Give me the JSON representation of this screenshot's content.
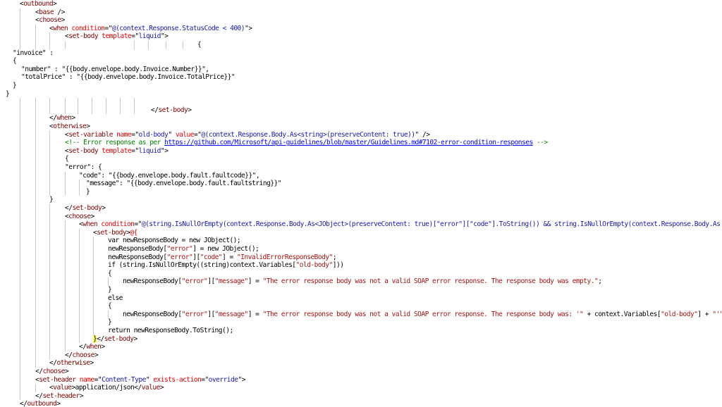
{
  "editor": {
    "lines": [
      {
        "segs": [
          {
            "c": "p",
            "t": "<"
          },
          {
            "c": "t",
            "t": "outbound"
          },
          {
            "c": "p",
            "t": ">"
          }
        ]
      },
      {
        "segs": [
          {
            "c": "p",
            "t": "<"
          },
          {
            "c": "t",
            "t": "base"
          },
          {
            "c": "p",
            "t": " />"
          }
        ]
      },
      {
        "segs": [
          {
            "c": "p",
            "t": "<"
          },
          {
            "c": "t",
            "t": "choose"
          },
          {
            "c": "p",
            "t": ">"
          }
        ]
      },
      {
        "segs": [
          {
            "c": "p",
            "t": "<"
          },
          {
            "c": "t",
            "t": "when"
          },
          {
            "c": "a",
            "t": " condition"
          },
          {
            "c": "p",
            "t": "=\""
          },
          {
            "c": "v",
            "t": "@(context.Response.StatusCode < 400)"
          },
          {
            "c": "p",
            "t": "\">"
          }
        ]
      },
      {
        "segs": [
          {
            "c": "p",
            "t": "<"
          },
          {
            "c": "t",
            "t": "set-body"
          },
          {
            "c": "a",
            "t": " template"
          },
          {
            "c": "p",
            "t": "=\""
          },
          {
            "c": "v",
            "t": "liquid"
          },
          {
            "c": "p",
            "t": "\">"
          }
        ]
      },
      {
        "segs": [
          {
            "c": "p",
            "t": "{"
          }
        ]
      },
      {
        "segs": [
          {
            "c": "p",
            "t": "\"invoice\" :"
          }
        ]
      },
      {
        "segs": [
          {
            "c": "p",
            "t": "{"
          }
        ]
      },
      {
        "segs": [
          {
            "c": "p",
            "t": "\"number\" : \"{{body.envelope.body.Invoice.Number}}\","
          }
        ]
      },
      {
        "segs": [
          {
            "c": "p",
            "t": "\"totalPrice\" : \"{{body.envelope.body.Invoice.TotalPrice}}\""
          }
        ]
      },
      {
        "segs": [
          {
            "c": "p",
            "t": "}"
          }
        ]
      },
      {
        "segs": [
          {
            "c": "p",
            "t": "}"
          }
        ]
      },
      {
        "segs": []
      },
      {
        "segs": [
          {
            "c": "p",
            "t": "</"
          },
          {
            "c": "t",
            "t": "set-body"
          },
          {
            "c": "p",
            "t": ">"
          }
        ]
      },
      {
        "segs": [
          {
            "c": "p",
            "t": "</"
          },
          {
            "c": "t",
            "t": "when"
          },
          {
            "c": "p",
            "t": ">"
          }
        ]
      },
      {
        "segs": [
          {
            "c": "p",
            "t": "<"
          },
          {
            "c": "t",
            "t": "otherwise"
          },
          {
            "c": "p",
            "t": ">"
          }
        ]
      },
      {
        "segs": [
          {
            "c": "p",
            "t": "<"
          },
          {
            "c": "t",
            "t": "set-variable"
          },
          {
            "c": "a",
            "t": " name"
          },
          {
            "c": "p",
            "t": "=\""
          },
          {
            "c": "v",
            "t": "old-body"
          },
          {
            "c": "p",
            "t": "\""
          },
          {
            "c": "a",
            "t": " value"
          },
          {
            "c": "p",
            "t": "=\""
          },
          {
            "c": "v",
            "t": "@(context.Response.Body.As<string>(preserveContent: true))"
          },
          {
            "c": "p",
            "t": "\" />"
          }
        ]
      },
      {
        "segs": [
          {
            "c": "c",
            "t": "<!-- Error response as per "
          },
          {
            "c": "u",
            "t": "https://github.com/Microsoft/api-guidelines/blob/master/Guidelines.md#7102-error-condition-responses"
          },
          {
            "c": "c",
            "t": " -->"
          }
        ]
      },
      {
        "segs": [
          {
            "c": "p",
            "t": "<"
          },
          {
            "c": "t",
            "t": "set-body"
          },
          {
            "c": "a",
            "t": " template"
          },
          {
            "c": "p",
            "t": "=\""
          },
          {
            "c": "v",
            "t": "liquid"
          },
          {
            "c": "p",
            "t": "\">"
          }
        ]
      },
      {
        "segs": [
          {
            "c": "p",
            "t": "{"
          }
        ]
      },
      {
        "segs": [
          {
            "c": "p",
            "t": "\"error\": {"
          }
        ]
      },
      {
        "segs": [
          {
            "c": "p",
            "t": "\"code\": \"{{body.envelope.body.fault.faultcode}}\","
          }
        ]
      },
      {
        "segs": [
          {
            "c": "p",
            "t": "\"message\": \"{{body.envelope.body.fault.faultstring}}\""
          }
        ]
      },
      {
        "segs": [
          {
            "c": "p",
            "t": "}"
          }
        ]
      },
      {
        "segs": [
          {
            "c": "p",
            "t": "}"
          }
        ]
      },
      {
        "segs": [
          {
            "c": "p",
            "t": "</"
          },
          {
            "c": "t",
            "t": "set-body"
          },
          {
            "c": "p",
            "t": ">"
          }
        ]
      },
      {
        "segs": [
          {
            "c": "p",
            "t": "<"
          },
          {
            "c": "t",
            "t": "choose"
          },
          {
            "c": "p",
            "t": ">"
          }
        ]
      },
      {
        "segs": [
          {
            "c": "p",
            "t": "<"
          },
          {
            "c": "t",
            "t": "when"
          },
          {
            "c": "a",
            "t": " condition"
          },
          {
            "c": "p",
            "t": "=\""
          },
          {
            "c": "v",
            "t": "@(string.IsNullOrEmpty(context.Response.Body.As<JObject>(preserveContent: true)[\"error\"][\"code\"].ToString()) && string.IsNullOrEmpty(context.Response.Body.As"
          }
        ]
      },
      {
        "segs": [
          {
            "c": "p",
            "t": "<"
          },
          {
            "c": "t",
            "t": "set-body"
          },
          {
            "c": "p",
            "t": ">"
          },
          {
            "c": "a",
            "t": "@{"
          }
        ]
      },
      {
        "segs": [
          {
            "c": "p",
            "t": "var newResponseBody = new JObject();"
          }
        ]
      },
      {
        "segs": [
          {
            "c": "p",
            "t": "newResponseBody["
          },
          {
            "c": "s",
            "t": "\"error\""
          },
          {
            "c": "p",
            "t": "] = new JObject();"
          }
        ]
      },
      {
        "segs": [
          {
            "c": "p",
            "t": "newResponseBody["
          },
          {
            "c": "s",
            "t": "\"error\""
          },
          {
            "c": "p",
            "t": "]["
          },
          {
            "c": "s",
            "t": "\"code\""
          },
          {
            "c": "p",
            "t": "] = "
          },
          {
            "c": "s",
            "t": "\"InvalidErrorResponseBody\""
          },
          {
            "c": "p",
            "t": ";"
          }
        ]
      },
      {
        "segs": [
          {
            "c": "p",
            "t": "if (string.IsNullOrEmpty((string)context.Variables["
          },
          {
            "c": "s",
            "t": "\"old-body\""
          },
          {
            "c": "p",
            "t": "]))"
          }
        ]
      },
      {
        "segs": [
          {
            "c": "p",
            "t": "{"
          }
        ]
      },
      {
        "segs": [
          {
            "c": "p",
            "t": "newResponseBody["
          },
          {
            "c": "s",
            "t": "\"error\""
          },
          {
            "c": "p",
            "t": "]["
          },
          {
            "c": "s",
            "t": "\"message\""
          },
          {
            "c": "p",
            "t": "] = "
          },
          {
            "c": "s",
            "t": "\"The error response body was not a valid SOAP error response. The response body was empty.\""
          },
          {
            "c": "p",
            "t": ";"
          }
        ]
      },
      {
        "segs": [
          {
            "c": "p",
            "t": "}"
          }
        ]
      },
      {
        "segs": [
          {
            "c": "p",
            "t": "else"
          }
        ]
      },
      {
        "segs": [
          {
            "c": "p",
            "t": "{"
          }
        ]
      },
      {
        "segs": [
          {
            "c": "p",
            "t": "newResponseBody["
          },
          {
            "c": "s",
            "t": "\"error\""
          },
          {
            "c": "p",
            "t": "]["
          },
          {
            "c": "s",
            "t": "\"message\""
          },
          {
            "c": "p",
            "t": "] = "
          },
          {
            "c": "s",
            "t": "\"The error response body was not a valid SOAP error response. The response body was: '\""
          },
          {
            "c": "p",
            "t": " + context.Variables["
          },
          {
            "c": "s",
            "t": "\"old-body\""
          },
          {
            "c": "p",
            "t": "] + "
          },
          {
            "c": "s",
            "t": "\"'\""
          }
        ]
      },
      {
        "segs": [
          {
            "c": "p",
            "t": "}"
          }
        ]
      },
      {
        "segs": [
          {
            "c": "p",
            "t": "return newResponseBody.ToString();"
          }
        ]
      },
      {
        "segs": [
          {
            "c": "h",
            "t": "}"
          },
          {
            "c": "p",
            "t": "</"
          },
          {
            "c": "t",
            "t": "set-body"
          },
          {
            "c": "p",
            "t": ">"
          }
        ]
      },
      {
        "segs": [
          {
            "c": "p",
            "t": "</"
          },
          {
            "c": "t",
            "t": "when"
          },
          {
            "c": "p",
            "t": ">"
          }
        ]
      },
      {
        "segs": [
          {
            "c": "p",
            "t": "</"
          },
          {
            "c": "t",
            "t": "choose"
          },
          {
            "c": "p",
            "t": ">"
          }
        ]
      },
      {
        "segs": [
          {
            "c": "p",
            "t": "</"
          },
          {
            "c": "t",
            "t": "otherwise"
          },
          {
            "c": "p",
            "t": ">"
          }
        ]
      },
      {
        "segs": [
          {
            "c": "p",
            "t": "</"
          },
          {
            "c": "t",
            "t": "choose"
          },
          {
            "c": "p",
            "t": ">"
          }
        ]
      },
      {
        "segs": [
          {
            "c": "p",
            "t": "<"
          },
          {
            "c": "t",
            "t": "set-header"
          },
          {
            "c": "a",
            "t": " name"
          },
          {
            "c": "p",
            "t": "=\""
          },
          {
            "c": "v",
            "t": "Content-Type"
          },
          {
            "c": "p",
            "t": "\""
          },
          {
            "c": "a",
            "t": " exists-action"
          },
          {
            "c": "p",
            "t": "=\""
          },
          {
            "c": "v",
            "t": "override"
          },
          {
            "c": "p",
            "t": "\">"
          }
        ]
      },
      {
        "segs": [
          {
            "c": "p",
            "t": "<"
          },
          {
            "c": "t",
            "t": "value"
          },
          {
            "c": "p",
            "t": ">application/json</"
          },
          {
            "c": "t",
            "t": "value"
          },
          {
            "c": "p",
            "t": ">"
          }
        ]
      },
      {
        "segs": [
          {
            "c": "p",
            "t": "</"
          },
          {
            "c": "t",
            "t": "set-header"
          },
          {
            "c": "p",
            "t": ">"
          }
        ]
      },
      {
        "segs": [
          {
            "c": "p",
            "t": "</"
          },
          {
            "c": "t",
            "t": "outbound"
          },
          {
            "c": "p",
            "t": ">"
          }
        ]
      }
    ]
  }
}
